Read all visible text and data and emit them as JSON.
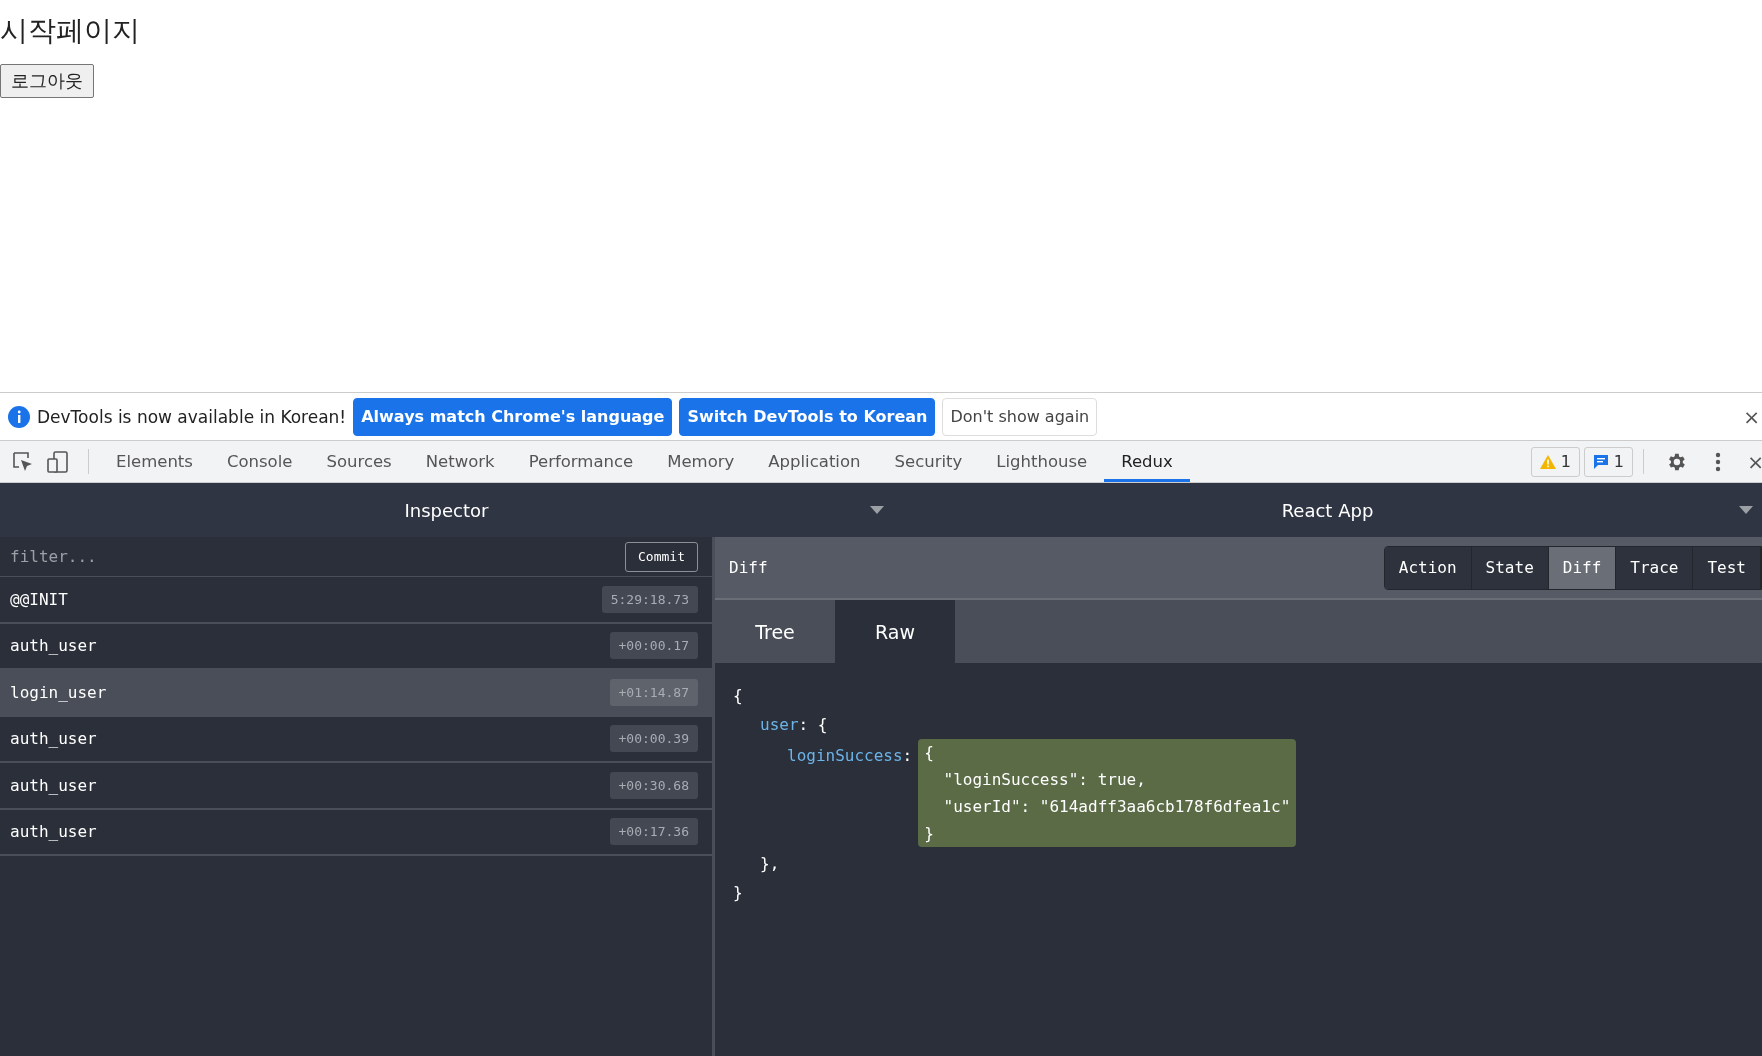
{
  "page": {
    "heading": "시작페이지",
    "logout_button": "로그아웃"
  },
  "infobar": {
    "message": "DevTools is now available in Korean!",
    "buttons": [
      {
        "label": "Always match Chrome's language",
        "kind": "primary"
      },
      {
        "label": "Switch DevTools to Korean",
        "kind": "primary"
      },
      {
        "label": "Don't show again",
        "kind": "plain"
      }
    ],
    "close": "×"
  },
  "devtools_tabs": [
    {
      "label": "Elements",
      "selected": false
    },
    {
      "label": "Console",
      "selected": false
    },
    {
      "label": "Sources",
      "selected": false
    },
    {
      "label": "Network",
      "selected": false
    },
    {
      "label": "Performance",
      "selected": false
    },
    {
      "label": "Memory",
      "selected": false
    },
    {
      "label": "Application",
      "selected": false
    },
    {
      "label": "Security",
      "selected": false
    },
    {
      "label": "Lighthouse",
      "selected": false
    },
    {
      "label": "Redux",
      "selected": true
    }
  ],
  "toolbar_right": {
    "warnings": "1",
    "messages": "1",
    "close": "×"
  },
  "redux": {
    "left_title": "Inspector",
    "right_title": "React App",
    "filter": {
      "placeholder": "filter..."
    },
    "commit_button": "Commit",
    "actions": [
      {
        "name": "@@INIT",
        "time": "5:29:18.73",
        "selected": false
      },
      {
        "name": "auth_user",
        "time": "+00:00.17",
        "selected": false
      },
      {
        "name": "login_user",
        "time": "+01:14.87",
        "selected": true
      },
      {
        "name": "auth_user",
        "time": "+00:00.39",
        "selected": false
      },
      {
        "name": "auth_user",
        "time": "+00:30.68",
        "selected": false
      },
      {
        "name": "auth_user",
        "time": "+00:17.36",
        "selected": false
      }
    ],
    "panel_title": "Diff",
    "monitor_tabs": [
      {
        "label": "Action",
        "selected": false
      },
      {
        "label": "State",
        "selected": false
      },
      {
        "label": "Diff",
        "selected": true
      },
      {
        "label": "Trace",
        "selected": false
      },
      {
        "label": "Test",
        "selected": false
      }
    ],
    "view_tabs": [
      {
        "label": "Tree",
        "selected": false
      },
      {
        "label": "Raw",
        "selected": true
      }
    ],
    "raw": {
      "open": "{",
      "outer_key": "user",
      "outer_open": ": {",
      "inner_key": "loginSuccess",
      "inner_sep": ":",
      "added_block": [
        "{",
        "  \"loginSuccess\": true,",
        "  \"userId\": \"614adff3aa6cb178f6dfea1c\"",
        "}"
      ],
      "outer_close": "},",
      "close": "}"
    }
  }
}
